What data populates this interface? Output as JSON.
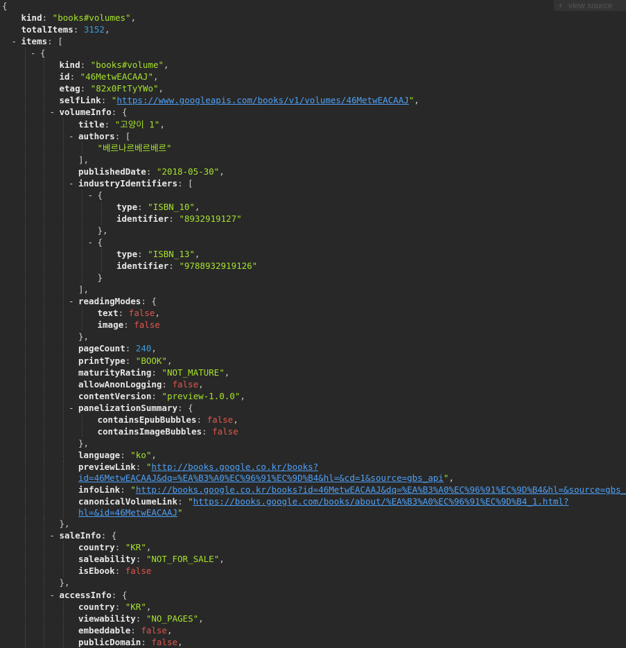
{
  "toolbar": {
    "view_source_label": "view source",
    "plus": "+"
  },
  "lines": [
    {
      "d": 0,
      "p": [
        [
          "punc",
          "{"
        ]
      ]
    },
    {
      "d": 1,
      "p": [
        [
          "key",
          "kind"
        ],
        [
          "punc",
          ": "
        ],
        [
          "str",
          "\"books#volumes\""
        ],
        [
          "punc",
          ","
        ]
      ]
    },
    {
      "d": 1,
      "p": [
        [
          "key",
          "totalItems"
        ],
        [
          "punc",
          ": "
        ],
        [
          "num",
          "3152"
        ],
        [
          "punc",
          ","
        ]
      ]
    },
    {
      "d": 1,
      "t": 1,
      "p": [
        [
          "key",
          "items"
        ],
        [
          "punc",
          ": ["
        ]
      ]
    },
    {
      "d": 2,
      "t": 1,
      "p": [
        [
          "punc",
          "{"
        ]
      ]
    },
    {
      "d": 3,
      "p": [
        [
          "key",
          "kind"
        ],
        [
          "punc",
          ": "
        ],
        [
          "str",
          "\"books#volume\""
        ],
        [
          "punc",
          ","
        ]
      ]
    },
    {
      "d": 3,
      "p": [
        [
          "key",
          "id"
        ],
        [
          "punc",
          ": "
        ],
        [
          "str",
          "\"46MetwEACAAJ\""
        ],
        [
          "punc",
          ","
        ]
      ]
    },
    {
      "d": 3,
      "p": [
        [
          "key",
          "etag"
        ],
        [
          "punc",
          ": "
        ],
        [
          "str",
          "\"82x0FtTyYWo\""
        ],
        [
          "punc",
          ","
        ]
      ]
    },
    {
      "d": 3,
      "p": [
        [
          "key",
          "selfLink"
        ],
        [
          "punc",
          ": "
        ],
        [
          "q",
          "\""
        ],
        [
          "link",
          "https://www.googleapis.com/books/v1/volumes/46MetwEACAAJ"
        ],
        [
          "q",
          "\""
        ],
        [
          "punc",
          ","
        ]
      ]
    },
    {
      "d": 3,
      "t": 1,
      "p": [
        [
          "key",
          "volumeInfo"
        ],
        [
          "punc",
          ": {"
        ]
      ]
    },
    {
      "d": 4,
      "p": [
        [
          "key",
          "title"
        ],
        [
          "punc",
          ": "
        ],
        [
          "str",
          "\"고양이 1\""
        ],
        [
          "punc",
          ","
        ]
      ]
    },
    {
      "d": 4,
      "t": 1,
      "p": [
        [
          "key",
          "authors"
        ],
        [
          "punc",
          ": ["
        ]
      ]
    },
    {
      "d": 5,
      "p": [
        [
          "str",
          "\"베르나르베르베르\""
        ]
      ]
    },
    {
      "d": 4,
      "p": [
        [
          "punc",
          "],"
        ]
      ]
    },
    {
      "d": 4,
      "p": [
        [
          "key",
          "publishedDate"
        ],
        [
          "punc",
          ": "
        ],
        [
          "str",
          "\"2018-05-30\""
        ],
        [
          "punc",
          ","
        ]
      ]
    },
    {
      "d": 4,
      "t": 1,
      "p": [
        [
          "key",
          "industryIdentifiers"
        ],
        [
          "punc",
          ": ["
        ]
      ]
    },
    {
      "d": 5,
      "t": 1,
      "p": [
        [
          "punc",
          "{"
        ]
      ]
    },
    {
      "d": 6,
      "p": [
        [
          "key",
          "type"
        ],
        [
          "punc",
          ": "
        ],
        [
          "str",
          "\"ISBN_10\""
        ],
        [
          "punc",
          ","
        ]
      ]
    },
    {
      "d": 6,
      "p": [
        [
          "key",
          "identifier"
        ],
        [
          "punc",
          ": "
        ],
        [
          "str",
          "\"8932919127\""
        ]
      ]
    },
    {
      "d": 5,
      "p": [
        [
          "punc",
          "},"
        ]
      ]
    },
    {
      "d": 5,
      "t": 1,
      "p": [
        [
          "punc",
          "{"
        ]
      ]
    },
    {
      "d": 6,
      "p": [
        [
          "key",
          "type"
        ],
        [
          "punc",
          ": "
        ],
        [
          "str",
          "\"ISBN_13\""
        ],
        [
          "punc",
          ","
        ]
      ]
    },
    {
      "d": 6,
      "p": [
        [
          "key",
          "identifier"
        ],
        [
          "punc",
          ": "
        ],
        [
          "str",
          "\"9788932919126\""
        ]
      ]
    },
    {
      "d": 5,
      "p": [
        [
          "punc",
          "}"
        ]
      ]
    },
    {
      "d": 4,
      "p": [
        [
          "punc",
          "],"
        ]
      ]
    },
    {
      "d": 4,
      "t": 1,
      "p": [
        [
          "key",
          "readingModes"
        ],
        [
          "punc",
          ": {"
        ]
      ]
    },
    {
      "d": 5,
      "p": [
        [
          "key",
          "text"
        ],
        [
          "punc",
          ": "
        ],
        [
          "bool",
          "false"
        ],
        [
          "punc",
          ","
        ]
      ]
    },
    {
      "d": 5,
      "p": [
        [
          "key",
          "image"
        ],
        [
          "punc",
          ": "
        ],
        [
          "bool",
          "false"
        ]
      ]
    },
    {
      "d": 4,
      "p": [
        [
          "punc",
          "},"
        ]
      ]
    },
    {
      "d": 4,
      "p": [
        [
          "key",
          "pageCount"
        ],
        [
          "punc",
          ": "
        ],
        [
          "num",
          "240"
        ],
        [
          "punc",
          ","
        ]
      ]
    },
    {
      "d": 4,
      "p": [
        [
          "key",
          "printType"
        ],
        [
          "punc",
          ": "
        ],
        [
          "str",
          "\"BOOK\""
        ],
        [
          "punc",
          ","
        ]
      ]
    },
    {
      "d": 4,
      "p": [
        [
          "key",
          "maturityRating"
        ],
        [
          "punc",
          ": "
        ],
        [
          "str",
          "\"NOT_MATURE\""
        ],
        [
          "punc",
          ","
        ]
      ]
    },
    {
      "d": 4,
      "p": [
        [
          "key",
          "allowAnonLogging"
        ],
        [
          "punc",
          ": "
        ],
        [
          "bool",
          "false"
        ],
        [
          "punc",
          ","
        ]
      ]
    },
    {
      "d": 4,
      "p": [
        [
          "key",
          "contentVersion"
        ],
        [
          "punc",
          ": "
        ],
        [
          "str",
          "\"preview-1.0.0\""
        ],
        [
          "punc",
          ","
        ]
      ]
    },
    {
      "d": 4,
      "t": 1,
      "p": [
        [
          "key",
          "panelizationSummary"
        ],
        [
          "punc",
          ": {"
        ]
      ]
    },
    {
      "d": 5,
      "p": [
        [
          "key",
          "containsEpubBubbles"
        ],
        [
          "punc",
          ": "
        ],
        [
          "bool",
          "false"
        ],
        [
          "punc",
          ","
        ]
      ]
    },
    {
      "d": 5,
      "p": [
        [
          "key",
          "containsImageBubbles"
        ],
        [
          "punc",
          ": "
        ],
        [
          "bool",
          "false"
        ]
      ]
    },
    {
      "d": 4,
      "p": [
        [
          "punc",
          "},"
        ]
      ]
    },
    {
      "d": 4,
      "p": [
        [
          "key",
          "language"
        ],
        [
          "punc",
          ": "
        ],
        [
          "str",
          "\"ko\""
        ],
        [
          "punc",
          ","
        ]
      ]
    },
    {
      "d": 4,
      "tall": 1,
      "p": [
        [
          "key",
          "previewLink"
        ],
        [
          "punc",
          ": "
        ],
        [
          "q",
          "\""
        ],
        [
          "link",
          "http://books.google.co.kr/books?"
        ]
      ],
      "p2": [
        [
          "link",
          "id=46MetwEACAAJ&dq=%EA%B3%A0%EC%96%91%EC%9D%B4&hl=&cd=1&source=gbs_api"
        ],
        [
          "q",
          "\""
        ],
        [
          "punc",
          ","
        ]
      ]
    },
    {
      "d": 4,
      "p": [
        [
          "key",
          "infoLink"
        ],
        [
          "punc",
          ": "
        ],
        [
          "q",
          "\""
        ],
        [
          "link",
          "http://books.google.co.kr/books?id=46MetwEACAAJ&dq=%EA%B3%A0%EC%96%91%EC%9D%B4&hl=&source=gbs_api"
        ],
        [
          "q",
          "\""
        ],
        [
          "punc",
          ","
        ]
      ]
    },
    {
      "d": 4,
      "tall": 1,
      "p": [
        [
          "key",
          "canonicalVolumeLink"
        ],
        [
          "punc",
          ": "
        ],
        [
          "q",
          "\""
        ],
        [
          "link",
          "https://books.google.com/books/about/%EA%B3%A0%EC%96%91%EC%9D%B4_1.html?"
        ]
      ],
      "p2": [
        [
          "link",
          "hl=&id=46MetwEACAAJ"
        ],
        [
          "q",
          "\""
        ]
      ]
    },
    {
      "d": 3,
      "p": [
        [
          "punc",
          "},"
        ]
      ]
    },
    {
      "d": 3,
      "t": 1,
      "p": [
        [
          "key",
          "saleInfo"
        ],
        [
          "punc",
          ": {"
        ]
      ]
    },
    {
      "d": 4,
      "p": [
        [
          "key",
          "country"
        ],
        [
          "punc",
          ": "
        ],
        [
          "str",
          "\"KR\""
        ],
        [
          "punc",
          ","
        ]
      ]
    },
    {
      "d": 4,
      "p": [
        [
          "key",
          "saleability"
        ],
        [
          "punc",
          ": "
        ],
        [
          "str",
          "\"NOT_FOR_SALE\""
        ],
        [
          "punc",
          ","
        ]
      ]
    },
    {
      "d": 4,
      "p": [
        [
          "key",
          "isEbook"
        ],
        [
          "punc",
          ": "
        ],
        [
          "bool",
          "false"
        ]
      ]
    },
    {
      "d": 3,
      "p": [
        [
          "punc",
          "},"
        ]
      ]
    },
    {
      "d": 3,
      "t": 1,
      "p": [
        [
          "key",
          "accessInfo"
        ],
        [
          "punc",
          ": {"
        ]
      ]
    },
    {
      "d": 4,
      "p": [
        [
          "key",
          "country"
        ],
        [
          "punc",
          ": "
        ],
        [
          "str",
          "\"KR\""
        ],
        [
          "punc",
          ","
        ]
      ]
    },
    {
      "d": 4,
      "p": [
        [
          "key",
          "viewability"
        ],
        [
          "punc",
          ": "
        ],
        [
          "str",
          "\"NO_PAGES\""
        ],
        [
          "punc",
          ","
        ]
      ]
    },
    {
      "d": 4,
      "p": [
        [
          "key",
          "embeddable"
        ],
        [
          "punc",
          ": "
        ],
        [
          "bool",
          "false"
        ],
        [
          "punc",
          ","
        ]
      ]
    },
    {
      "d": 4,
      "p": [
        [
          "key",
          "publicDomain"
        ],
        [
          "punc",
          ": "
        ],
        [
          "bool",
          "false"
        ],
        [
          "punc",
          ","
        ]
      ]
    }
  ],
  "toggle_symbol": "-"
}
